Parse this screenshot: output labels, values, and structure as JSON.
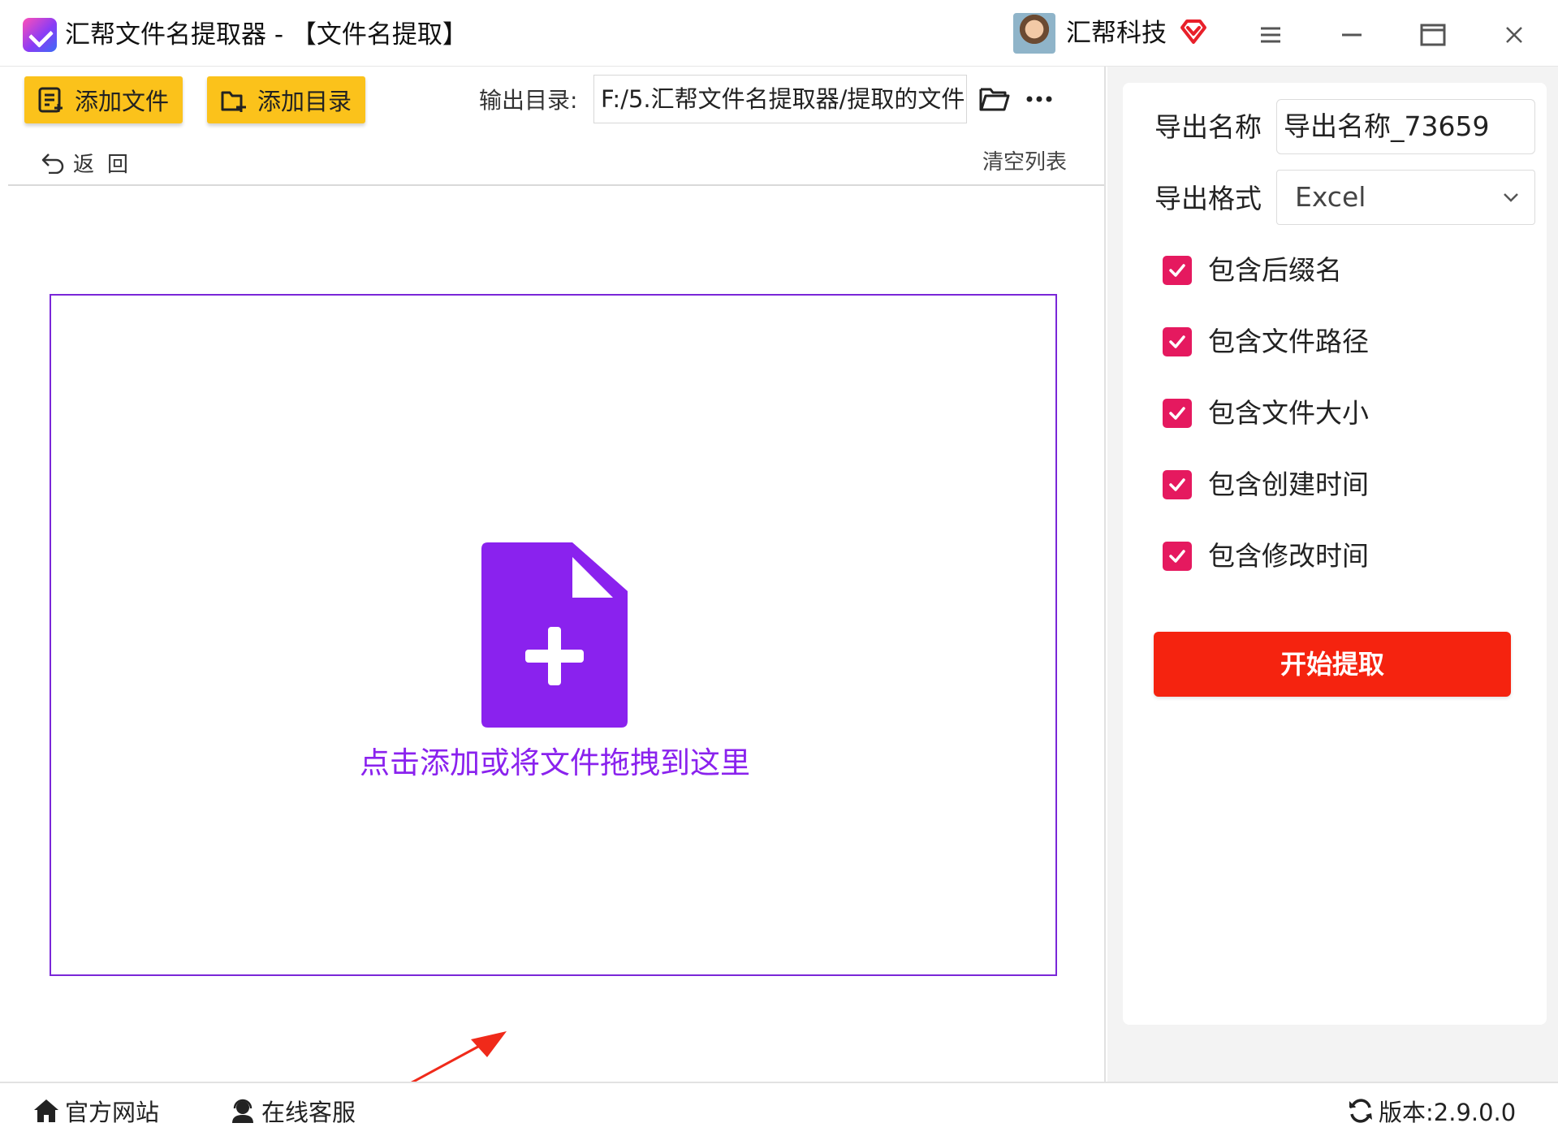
{
  "window": {
    "title": "汇帮文件名提取器 - 【文件名提取】",
    "brand": "汇帮科技"
  },
  "toolbar": {
    "add_file": "添加文件",
    "add_dir": "添加目录",
    "output_label": "输出目录:",
    "output_path": "F:/5.汇帮文件名提取器/提取的文件",
    "back": "返回",
    "clear_list": "清空列表"
  },
  "dropzone": {
    "hint": "点击添加或将文件拖拽到这里"
  },
  "settings": {
    "name_label": "导出名称",
    "name_value": "导出名称_73659",
    "format_label": "导出格式",
    "format_value": "Excel",
    "options": [
      {
        "label": "包含后缀名",
        "checked": true
      },
      {
        "label": "包含文件路径",
        "checked": true
      },
      {
        "label": "包含文件大小",
        "checked": true
      },
      {
        "label": "包含创建时间",
        "checked": true
      },
      {
        "label": "包含修改时间",
        "checked": true
      }
    ],
    "start_button": "开始提取"
  },
  "footer": {
    "website": "官方网站",
    "service": "在线客服",
    "version": "版本:2.9.0.0"
  },
  "colors": {
    "accent_yellow": "#fbc21b",
    "drop_purple": "#8a22ee",
    "checkbox_pink": "#e5195f",
    "start_red": "#f5230f"
  }
}
